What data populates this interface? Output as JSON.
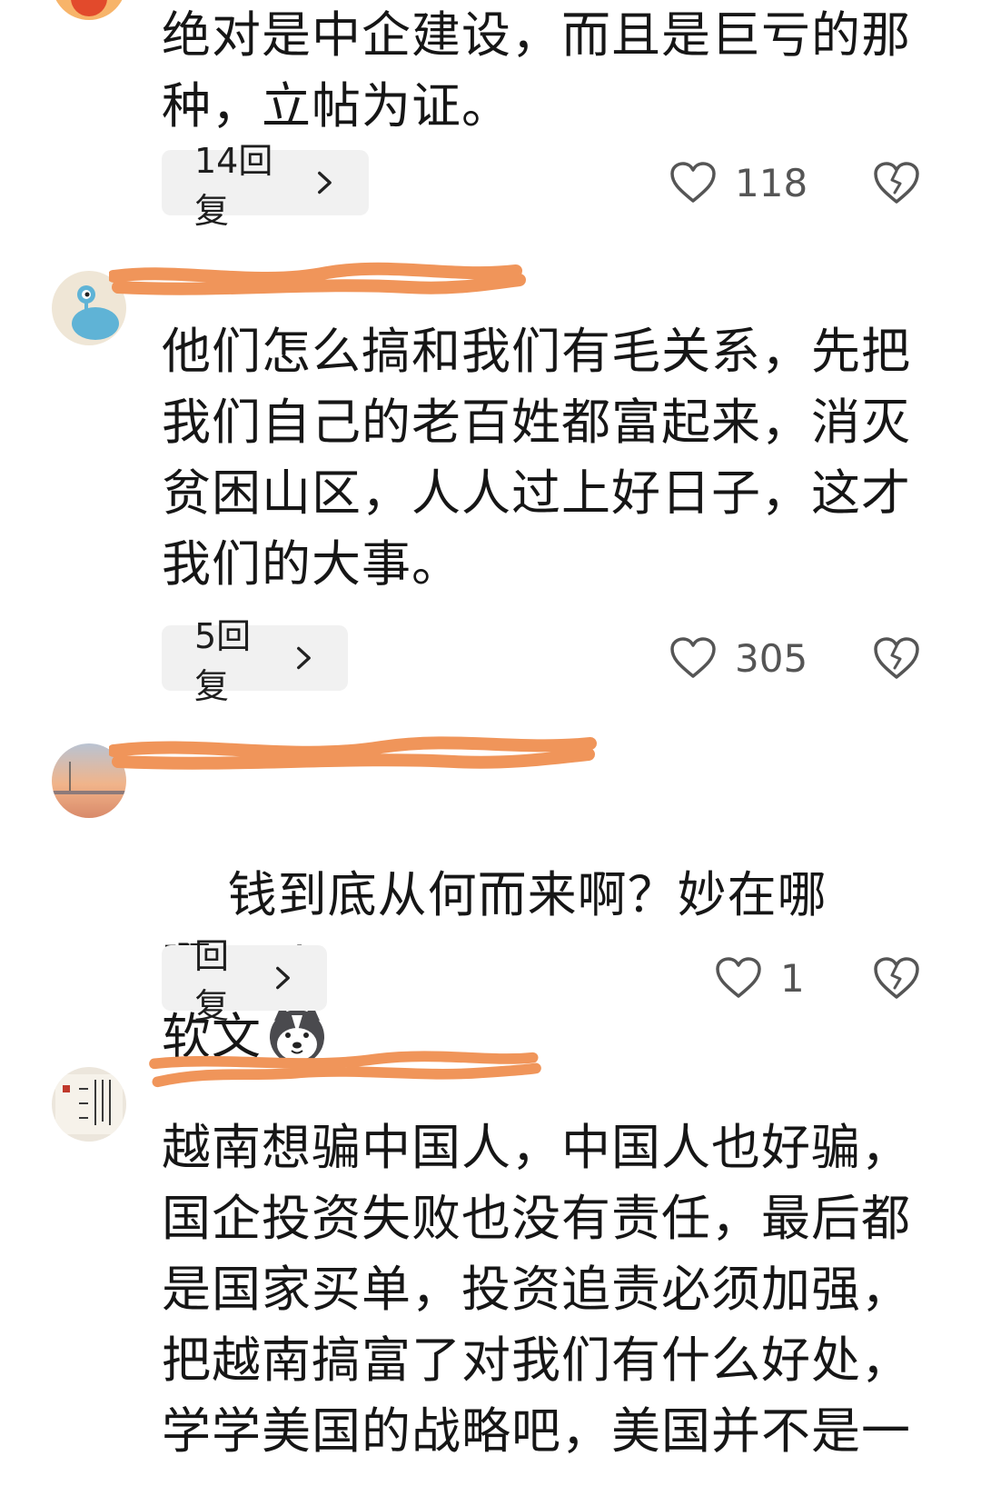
{
  "comments": [
    {
      "text": "绝对是中企建设，而且是巨亏的那\n种，立帖为证。",
      "reply_label": "14回复",
      "likes": "118"
    },
    {
      "text": "他们怎么搞和我们有毛关系，先把\n我们自己的老百姓都富起来，消灭\n贫困山区，人人过上好日子，这才\n我们的大事。",
      "reply_label": "5回复",
      "likes": "305"
    },
    {
      "text": "钱到底从何而来啊？妙在哪啊？ai\n软文",
      "emoji": "husky-dog-emoji",
      "reply_label": "回复",
      "likes": "1"
    },
    {
      "text": "越南想骗中国人，中国人也好骗，\n国企投资失败也没有责任，最后都\n是国家买单，投资追责必须加强，\n把越南搞富了对我们有什么好处，\n学学美国的战略吧，美国并不是一"
    }
  ],
  "colors": {
    "scribble": "#F0955A",
    "reply_bg": "#F1F1F1",
    "icon_gray": "#555555"
  },
  "icons": [
    "heart-icon",
    "broken-heart-icon",
    "chevron-right-icon"
  ]
}
